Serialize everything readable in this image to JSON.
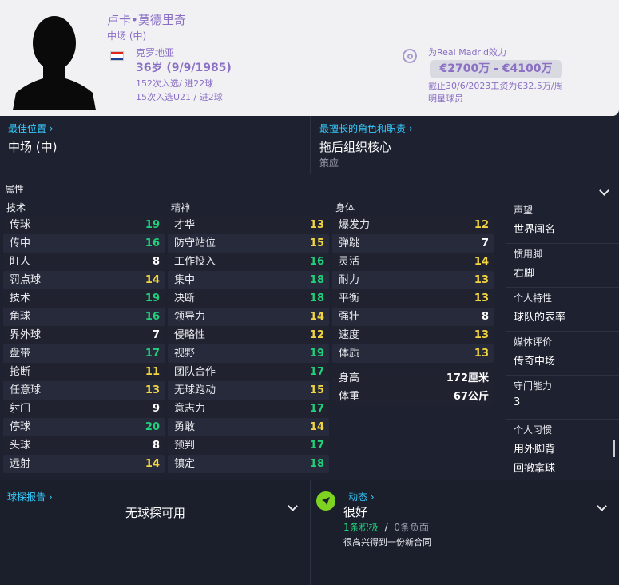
{
  "profile": {
    "name": "卢卡•莫德里奇",
    "position": "中场 (中)",
    "nationality": "克罗地亚",
    "age": "36岁 (9/9/1985)",
    "caps": "152次入选/ 进22球",
    "u21_caps": "15次入选U21 / 进2球"
  },
  "club": {
    "plays_for": "为Real Madrid效力",
    "value": "€2700万 - €4100万",
    "contract": "截止30/6/2023工资为€32.5万/周",
    "status": "明星球员"
  },
  "best_position": {
    "link": "最佳位置",
    "value": "中场 (中)"
  },
  "best_role": {
    "link": "最擅长的角色和职责",
    "value": "拖后组织核心",
    "duty": "策应"
  },
  "attributes": {
    "title": "属性",
    "technical": {
      "heading": "技术",
      "items": [
        {
          "name": "传球",
          "value": "19"
        },
        {
          "name": "传中",
          "value": "16"
        },
        {
          "name": "盯人",
          "value": "8"
        },
        {
          "name": "罚点球",
          "value": "14"
        },
        {
          "name": "技术",
          "value": "19"
        },
        {
          "name": "角球",
          "value": "16"
        },
        {
          "name": "界外球",
          "value": "7"
        },
        {
          "name": "盘带",
          "value": "17"
        },
        {
          "name": "抢断",
          "value": "11"
        },
        {
          "name": "任意球",
          "value": "13"
        },
        {
          "name": "射门",
          "value": "9"
        },
        {
          "name": "停球",
          "value": "20"
        },
        {
          "name": "头球",
          "value": "8"
        },
        {
          "name": "远射",
          "value": "14"
        }
      ]
    },
    "mental": {
      "heading": "精神",
      "items": [
        {
          "name": "才华",
          "value": "13"
        },
        {
          "name": "防守站位",
          "value": "15"
        },
        {
          "name": "工作投入",
          "value": "16"
        },
        {
          "name": "集中",
          "value": "18"
        },
        {
          "name": "决断",
          "value": "18"
        },
        {
          "name": "领导力",
          "value": "14"
        },
        {
          "name": "侵略性",
          "value": "12"
        },
        {
          "name": "视野",
          "value": "19"
        },
        {
          "name": "团队合作",
          "value": "17"
        },
        {
          "name": "无球跑动",
          "value": "15"
        },
        {
          "name": "意志力",
          "value": "17"
        },
        {
          "name": "勇敢",
          "value": "14"
        },
        {
          "name": "预判",
          "value": "17"
        },
        {
          "name": "镇定",
          "value": "18"
        }
      ]
    },
    "physical": {
      "heading": "身体",
      "items": [
        {
          "name": "爆发力",
          "value": "12"
        },
        {
          "name": "弹跳",
          "value": "7"
        },
        {
          "name": "灵活",
          "value": "14"
        },
        {
          "name": "耐力",
          "value": "13"
        },
        {
          "name": "平衡",
          "value": "13"
        },
        {
          "name": "强壮",
          "value": "8"
        },
        {
          "name": "速度",
          "value": "13"
        },
        {
          "name": "体质",
          "value": "13"
        }
      ],
      "height_label": "身高",
      "height": "172厘米",
      "weight_label": "体重",
      "weight": "67公斤"
    }
  },
  "side_info": [
    {
      "label": "声望",
      "value": "世界闻名"
    },
    {
      "label": "惯用脚",
      "value": "右脚"
    },
    {
      "label": "个人特性",
      "value": "球队的表率"
    },
    {
      "label": "媒体评价",
      "value": "传奇中场"
    },
    {
      "label": "守门能力",
      "value": "3"
    },
    {
      "label": "个人习惯",
      "value": "用外脚背",
      "value2": "回撤拿球"
    }
  ],
  "scout": {
    "link": "球探报告",
    "value": "无球探可用"
  },
  "news": {
    "link": "动态",
    "mood": "很好",
    "positive": "1条积极",
    "sep": "/",
    "negative": "0条负面",
    "detail": "很高兴得到一份新合同"
  },
  "colors": {
    "green": "#20d07a",
    "yellow": "#f2d541",
    "white": "#ffffff",
    "accent": "#33ccff"
  }
}
